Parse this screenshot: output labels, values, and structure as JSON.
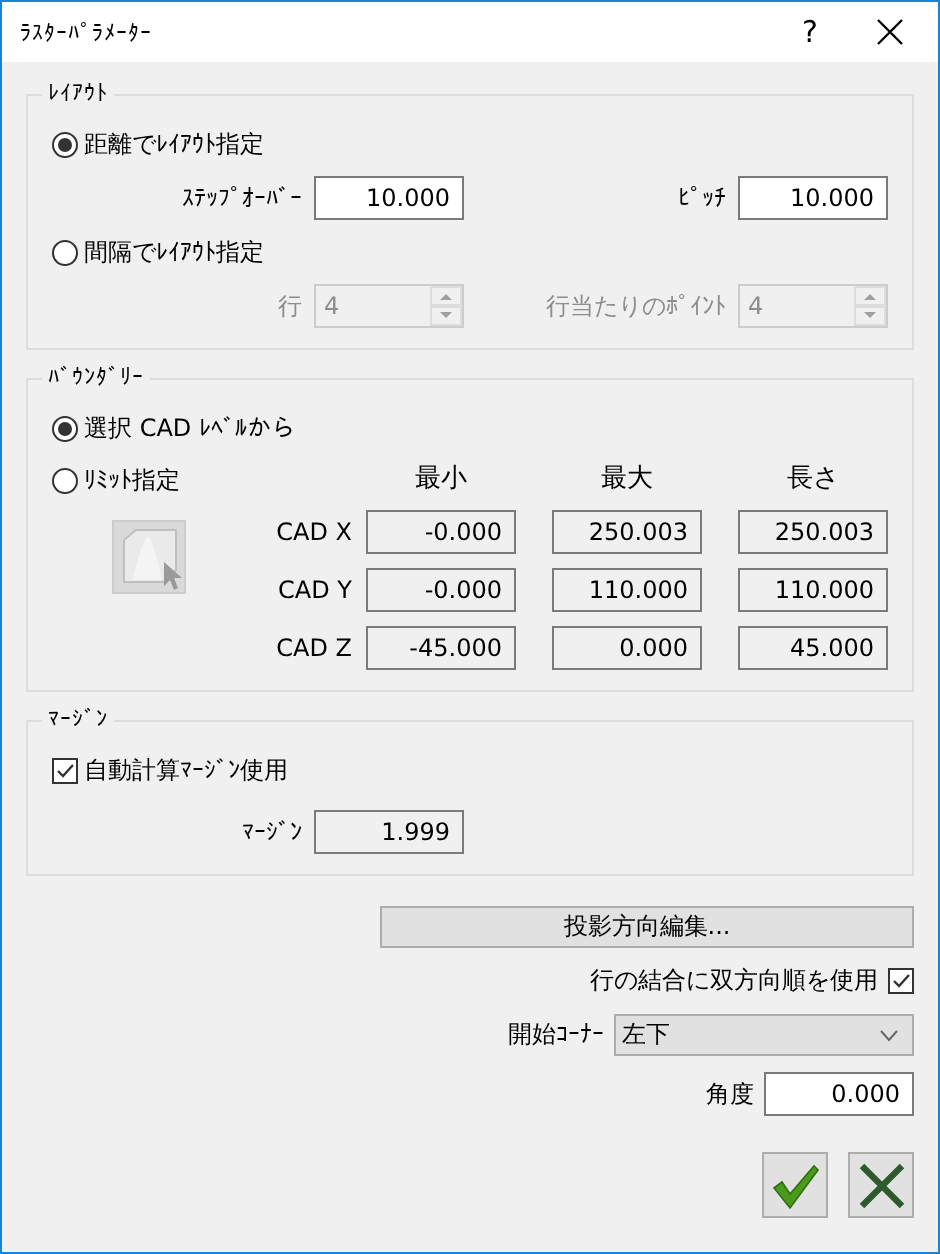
{
  "window": {
    "title": "ﾗｽﾀｰﾊﾟﾗﾒｰﾀｰ",
    "help": "?"
  },
  "layout": {
    "title": "ﾚｲｱｳﾄ",
    "options": [
      {
        "label": "距離でﾚｲｱｳﾄ指定",
        "selected": true,
        "fields": [
          {
            "label": "ｽﾃｯﾌﾟｵｰﾊﾞｰ",
            "value": "10.000",
            "kind": "number",
            "disabled": false
          },
          {
            "label": "ﾋﾟｯﾁ",
            "value": "10.000",
            "kind": "number",
            "disabled": false
          }
        ]
      },
      {
        "label": "間隔でﾚｲｱｳﾄ指定",
        "selected": false,
        "fields": [
          {
            "label": "行",
            "value": "4",
            "kind": "spin",
            "disabled": true
          },
          {
            "label": "行当たりのﾎﾟｲﾝﾄ",
            "value": "4",
            "kind": "spin",
            "disabled": true
          }
        ]
      }
    ]
  },
  "boundary": {
    "title": "ﾊﾞｳﾝﾀﾞﾘｰ",
    "options": [
      {
        "label": "選択 CAD ﾚﾍﾞﾙから",
        "selected": true
      },
      {
        "label": "ﾘﾐｯﾄ指定",
        "selected": false
      }
    ],
    "pick_button": {
      "disabled": true
    },
    "columns": [
      "最小",
      "最大",
      "長さ"
    ],
    "rows": [
      {
        "label": "CAD X",
        "values": [
          "-0.000",
          "250.003",
          "250.003"
        ]
      },
      {
        "label": "CAD Y",
        "values": [
          "-0.000",
          "110.000",
          "110.000"
        ]
      },
      {
        "label": "CAD Z",
        "values": [
          "-45.000",
          "0.000",
          "45.000"
        ]
      }
    ]
  },
  "margin": {
    "title": "ﾏｰｼﾞﾝ",
    "auto": {
      "label": "自動計算ﾏｰｼﾞﾝ使用",
      "checked": true
    },
    "field": {
      "label": "ﾏｰｼﾞﾝ",
      "value": "1.999",
      "disabled": true
    }
  },
  "edit_projection_button": "投影方向編集...",
  "bidirectional": {
    "label": "行の結合に双方向順を使用",
    "checked": true
  },
  "start_corner": {
    "label": "開始ｺｰﾅｰ",
    "value": "左下"
  },
  "angle": {
    "label": "角度",
    "value": "0.000"
  }
}
